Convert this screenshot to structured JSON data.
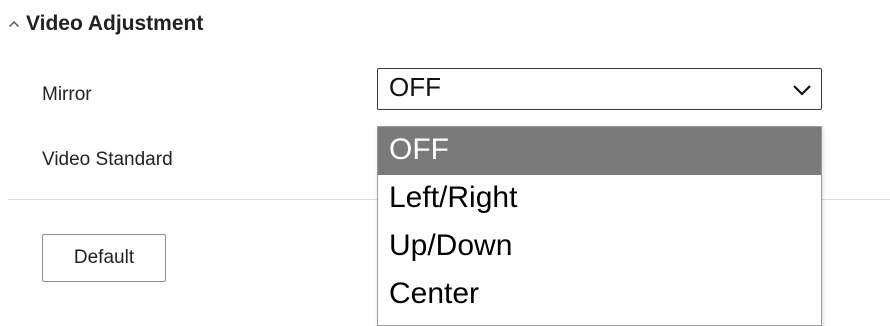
{
  "section": {
    "title": "Video Adjustment",
    "collapse_icon": "caret-up-icon"
  },
  "mirror": {
    "label": "Mirror",
    "value": "OFF",
    "options": [
      "OFF",
      "Left/Right",
      "Up/Down",
      "Center"
    ],
    "selected_index": 0
  },
  "video_standard": {
    "label": "Video Standard"
  },
  "buttons": {
    "default_label": "Default"
  },
  "colors": {
    "selected_option_bg": "#7a7a7a",
    "selected_option_text": "#ffffff",
    "border": "#3a3a3a",
    "divider": "#dcdcdc"
  }
}
